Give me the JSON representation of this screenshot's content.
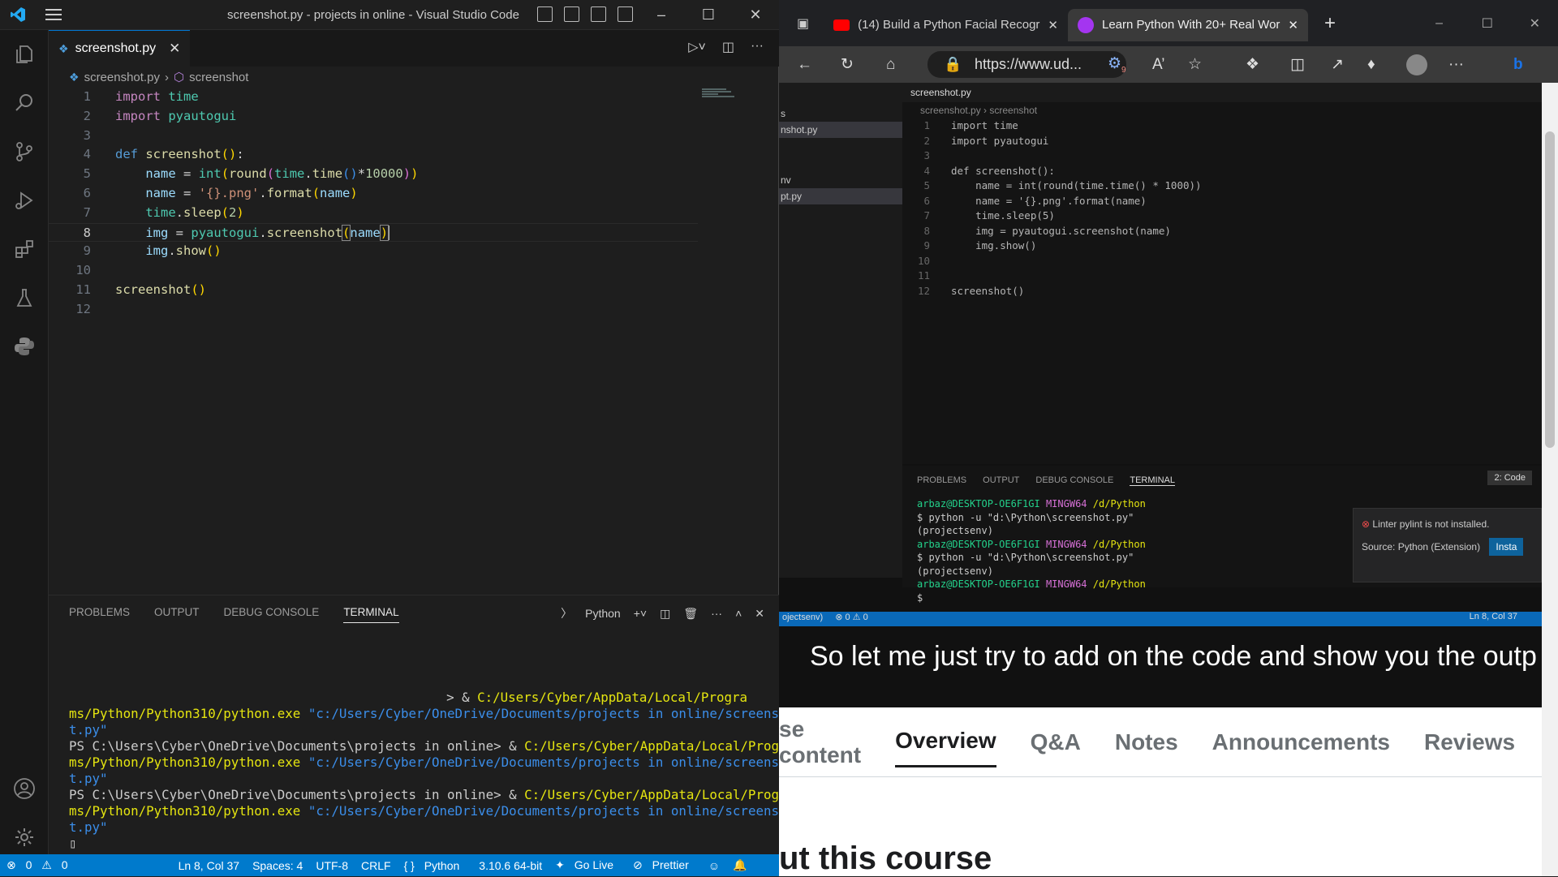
{
  "vscode": {
    "window_title": "screenshot.py - projects in online - Visual Studio Code",
    "tab": {
      "label": "screenshot.py"
    },
    "breadcrumb": {
      "file": "screenshot.py",
      "symbol": "screenshot"
    },
    "code_lines": [
      {
        "n": "1",
        "text": "import time"
      },
      {
        "n": "2",
        "text": "import pyautogui"
      },
      {
        "n": "3",
        "text": ""
      },
      {
        "n": "4",
        "text": "def screenshot():"
      },
      {
        "n": "5",
        "text": "    name = int(round(time.time()*10000))"
      },
      {
        "n": "6",
        "text": "    name = '{}.png'.format(name)"
      },
      {
        "n": "7",
        "text": "    time.sleep(2)"
      },
      {
        "n": "8",
        "text": "    img = pyautogui.screenshot(name)"
      },
      {
        "n": "9",
        "text": "    img.show()"
      },
      {
        "n": "10",
        "text": ""
      },
      {
        "n": "11",
        "text": "screenshot()"
      },
      {
        "n": "12",
        "text": ""
      }
    ],
    "panel_tabs": [
      "PROBLEMS",
      "OUTPUT",
      "DEBUG CONSOLE",
      "TERMINAL"
    ],
    "terminal_profile": "Python",
    "terminal": {
      "l1_prompt": "> & ",
      "l1_path": "C:/Users/Cyber/AppData/Local/Progra",
      "l2_path": "ms/Python/Python310/python.exe",
      "l2_arg": "\"c:/Users/Cyber/OneDrive/Documents/projects in online/screensho",
      "l3_arg": "t.py\"",
      "prompt": "PS C:\\Users\\Cyber\\OneDrive\\Documents\\projects in online> & "
    },
    "status": {
      "errors": "0",
      "warnings": "0",
      "position": "Ln 8, Col 37",
      "spaces": "Spaces: 4",
      "encoding": "UTF-8",
      "eol": "CRLF",
      "language": "Python",
      "interpreter": "3.10.6 64-bit",
      "golive": "Go Live",
      "prettier": "Prettier"
    }
  },
  "browser": {
    "tabs": [
      {
        "label": "(14) Build a Python Facial Recogr"
      },
      {
        "label": "Learn Python With 20+ Real Wor"
      }
    ],
    "url": "https://www.ud...",
    "badge": "9",
    "video": {
      "tab": "screenshot.py",
      "breadcrumb_file": "screenshot.py",
      "breadcrumb_symbol": "screenshot",
      "sidebar_items": [
        "s",
        "nshot.py",
        "nv",
        "pt.py"
      ],
      "code": [
        {
          "n": "1",
          "text": "import time"
        },
        {
          "n": "2",
          "text": "import pyautogui"
        },
        {
          "n": "3",
          "text": ""
        },
        {
          "n": "4",
          "text": "def screenshot():"
        },
        {
          "n": "5",
          "text": "    name = int(round(time.time() * 1000))"
        },
        {
          "n": "6",
          "text": "    name = '{}.png'.format(name)"
        },
        {
          "n": "7",
          "text": "    time.sleep(5)"
        },
        {
          "n": "8",
          "text": "    img = pyautogui.screenshot(name)"
        },
        {
          "n": "9",
          "text": "    img.show()"
        },
        {
          "n": "10",
          "text": ""
        },
        {
          "n": "11",
          "text": ""
        },
        {
          "n": "12",
          "text": "screenshot()"
        }
      ],
      "panel_tabs": [
        "PROBLEMS",
        "OUTPUT",
        "DEBUG CONSOLE",
        "TERMINAL"
      ],
      "terminal_select": "2: Code",
      "terminal_lines": [
        {
          "user": "arbaz@DESKTOP-OE6F1GI",
          "env": "MINGW64",
          "dir": "/d/Python"
        },
        {
          "cmd": "$ python -u \"d:\\Python\\screenshot.py\""
        },
        {
          "cmd": "(projectsenv)"
        },
        {
          "user": "arbaz@DESKTOP-OE6F1GI",
          "env": "MINGW64",
          "dir": "/d/Python"
        },
        {
          "cmd": "$ python -u \"d:\\Python\\screenshot.py\""
        },
        {
          "cmd": "(projectsenv)"
        },
        {
          "user": "arbaz@DESKTOP-OE6F1GI",
          "env": "MINGW64",
          "dir": "/d/Python"
        },
        {
          "cmd": "$ "
        }
      ],
      "notification": "Linter pylint is not installed.",
      "notification_source": "Source: Python (Extension)",
      "notification_button": "Insta",
      "status_left": "ojectsenv)",
      "status_problems": "0 ⚠ 0",
      "status_right": "Ln 8, Col 37",
      "caption": "So let me just try to add on the code and show you the outp"
    },
    "course_tabs": [
      "se content",
      "Overview",
      "Q&A",
      "Notes",
      "Announcements",
      "Reviews"
    ],
    "about_heading": "ut this course"
  }
}
